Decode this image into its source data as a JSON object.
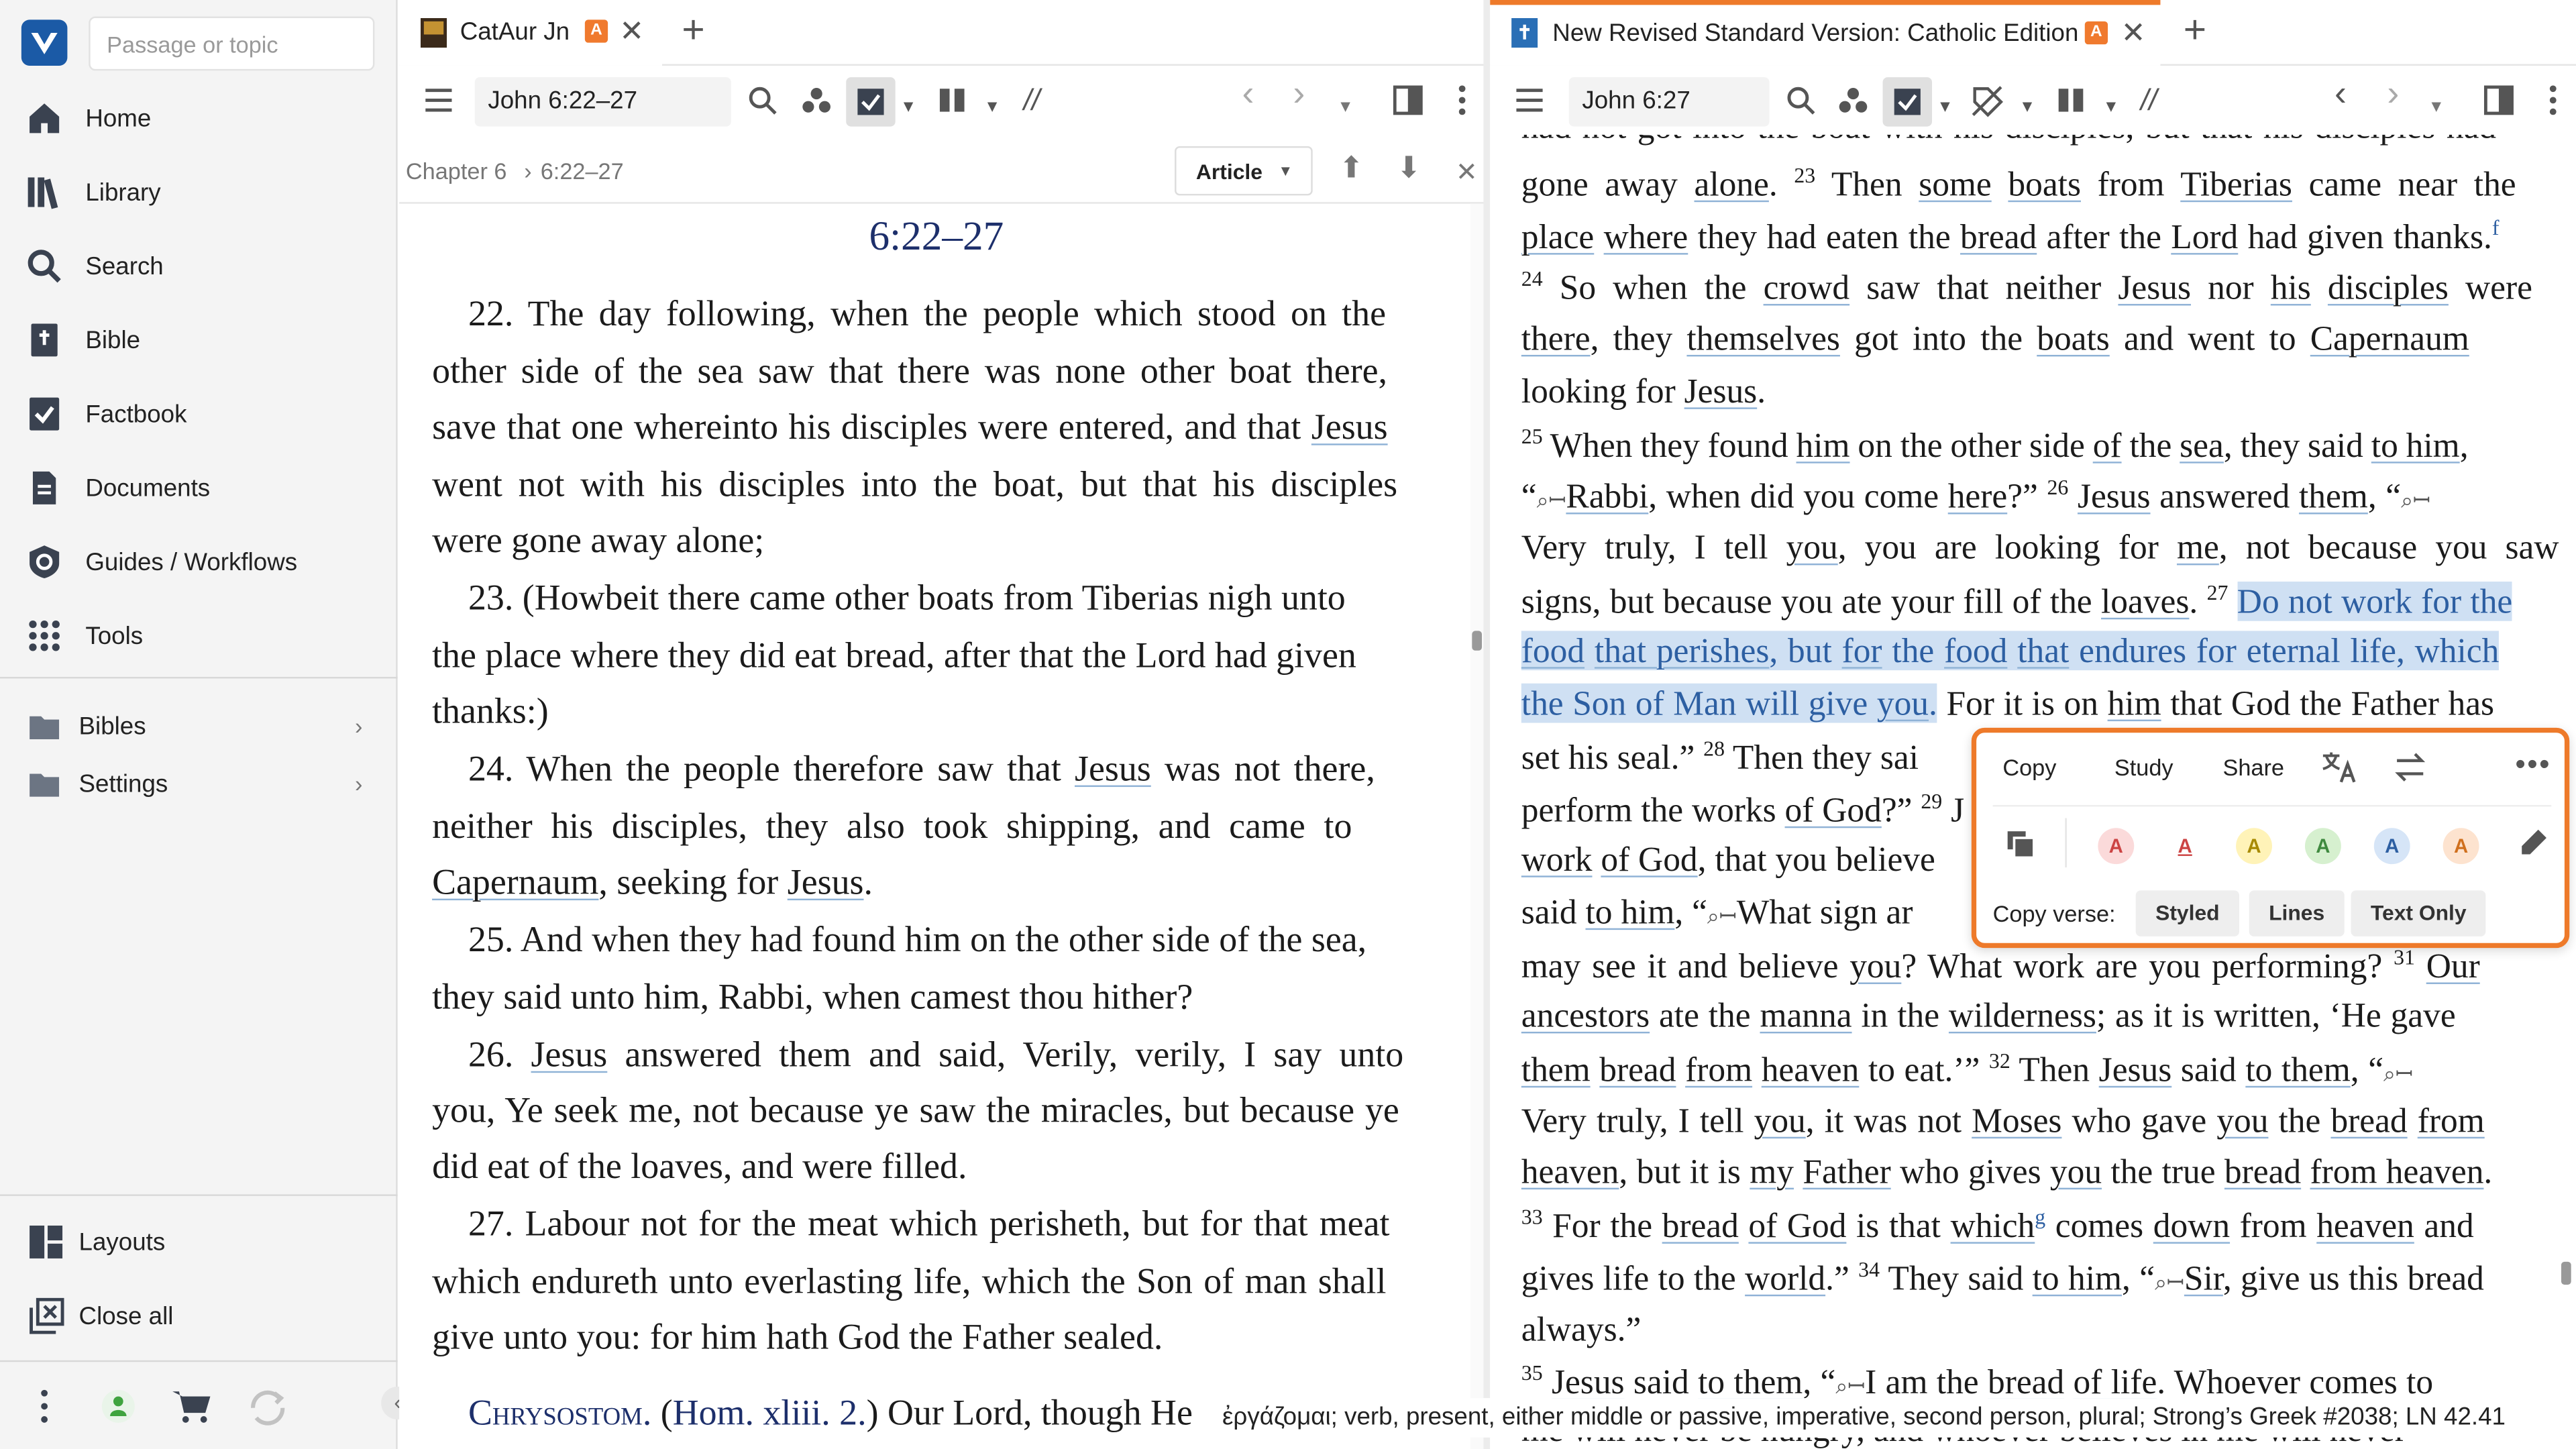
{
  "sidebar": {
    "search_placeholder": "Passage or topic",
    "items": [
      {
        "label": "Home",
        "icon": "home-icon"
      },
      {
        "label": "Library",
        "icon": "library-icon"
      },
      {
        "label": "Search",
        "icon": "search-icon"
      },
      {
        "label": "Bible",
        "icon": "bible-icon"
      },
      {
        "label": "Factbook",
        "icon": "factbook-icon"
      },
      {
        "label": "Documents",
        "icon": "documents-icon"
      },
      {
        "label": "Guides / Workflows",
        "icon": "guides-icon"
      },
      {
        "label": "Tools",
        "icon": "tools-icon"
      }
    ],
    "sections": [
      {
        "label": "Bibles",
        "icon": "folder-icon"
      },
      {
        "label": "Settings",
        "icon": "folder-icon"
      }
    ],
    "bottom_items": [
      {
        "label": "Layouts",
        "icon": "layouts-icon"
      },
      {
        "label": "Close all",
        "icon": "close-all-icon"
      }
    ]
  },
  "left_panel": {
    "tab_title": "CatAur Jn",
    "tab_badge": "A",
    "reference": "John 6:22–27",
    "breadcrumb_chapter": "Chapter 6",
    "breadcrumb_sep": "›",
    "breadcrumb_range": "6:22–27",
    "view_mode": "Article",
    "heading": "6:22–27",
    "status_text": "ἐργάζομαι; verb, present, either middle or passive, imperative, second person, plural; Strong’s Greek #2038; LN 42.41"
  },
  "right_panel": {
    "tab_title": "New Revised Standard Version: Catholic Edition",
    "tab_badge": "A",
    "reference": "John 6:27"
  },
  "popup": {
    "copy_label": "Copy",
    "study_label": "Study",
    "share_label": "Share",
    "copy_verse_label": "Copy verse:",
    "styled_label": "Styled",
    "lines_label": "Lines",
    "text_only_label": "Text Only",
    "highlight_glyph": "A"
  }
}
